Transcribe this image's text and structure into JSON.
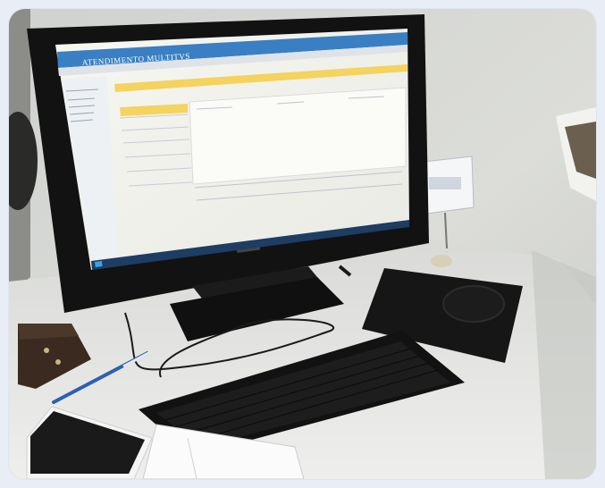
{
  "photo": {
    "screen_app_title": "ATENDIMENTO MULTITVS",
    "colors": {
      "wall": "#d8d9d6",
      "desk": "#e4e5e2",
      "monitor": "#141414",
      "screen_header": "#3a7fc3",
      "screen_bar": "#f4d35e",
      "keyboard": "#181818",
      "phone": "#f5f5f5",
      "pen": "#2d5fb3",
      "box": "#3a2a20"
    }
  }
}
